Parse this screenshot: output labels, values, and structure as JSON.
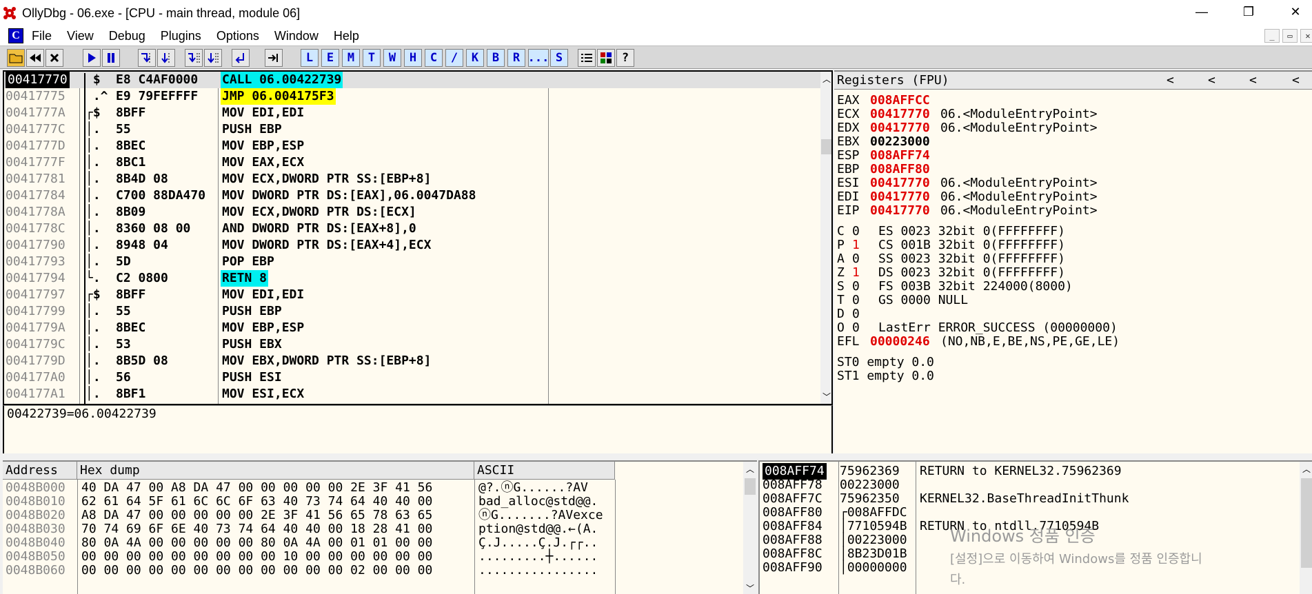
{
  "window": {
    "title": "OllyDbg - 06.exe - [CPU - main thread, module 06]",
    "minimize": "—",
    "restore": "❐",
    "close": "✕"
  },
  "menu": {
    "app_icon_letter": "C",
    "items": [
      "File",
      "View",
      "Debug",
      "Plugins",
      "Options",
      "Window",
      "Help"
    ],
    "mdi": [
      "_",
      "▭",
      "✕"
    ]
  },
  "toolbar": {
    "letters": [
      "L",
      "E",
      "M",
      "T",
      "W",
      "H",
      "C",
      "/",
      "K",
      "B",
      "R",
      "...",
      "S"
    ],
    "help": "?"
  },
  "disasm": {
    "rows": [
      {
        "addr": "00417770",
        "m": " $ ",
        "hex": "E8 C4AF0000",
        "asm": "CALL 06.00422739",
        "hl": "cyan",
        "sel": true
      },
      {
        "addr": "00417775",
        "m": " .^",
        "hex": "E9 79FEFFFF",
        "asm": "JMP 06.004175F3",
        "hl": "yellow"
      },
      {
        "addr": "0041777A",
        "m": "┌$ ",
        "hex": "8BFF",
        "asm": "MOV EDI,EDI"
      },
      {
        "addr": "0041777C",
        "m": "│. ",
        "hex": "55",
        "asm": "PUSH EBP"
      },
      {
        "addr": "0041777D",
        "m": "│. ",
        "hex": "8BEC",
        "asm": "MOV EBP,ESP"
      },
      {
        "addr": "0041777F",
        "m": "│. ",
        "hex": "8BC1",
        "asm": "MOV EAX,ECX"
      },
      {
        "addr": "00417781",
        "m": "│. ",
        "hex": "8B4D 08",
        "asm": "MOV ECX,DWORD PTR SS:[EBP+8]"
      },
      {
        "addr": "00417784",
        "m": "│. ",
        "hex": "C700 88DA470",
        "asm": "MOV DWORD PTR DS:[EAX],06.0047DA88"
      },
      {
        "addr": "0041778A",
        "m": "│. ",
        "hex": "8B09",
        "asm": "MOV ECX,DWORD PTR DS:[ECX]"
      },
      {
        "addr": "0041778C",
        "m": "│. ",
        "hex": "8360 08 00",
        "asm": "AND DWORD PTR DS:[EAX+8],0"
      },
      {
        "addr": "00417790",
        "m": "│. ",
        "hex": "8948 04",
        "asm": "MOV DWORD PTR DS:[EAX+4],ECX"
      },
      {
        "addr": "00417793",
        "m": "│. ",
        "hex": "5D",
        "asm": "POP EBP"
      },
      {
        "addr": "00417794",
        "m": "└. ",
        "hex": "C2 0800",
        "asm": "RETN 8",
        "hl": "cyan"
      },
      {
        "addr": "00417797",
        "m": "┌$ ",
        "hex": "8BFF",
        "asm": "MOV EDI,EDI"
      },
      {
        "addr": "00417799",
        "m": "│. ",
        "hex": "55",
        "asm": "PUSH EBP"
      },
      {
        "addr": "0041779A",
        "m": "│. ",
        "hex": "8BEC",
        "asm": "MOV EBP,ESP"
      },
      {
        "addr": "0041779C",
        "m": "│. ",
        "hex": "53",
        "asm": "PUSH EBX"
      },
      {
        "addr": "0041779D",
        "m": "│. ",
        "hex": "8B5D 08",
        "asm": "MOV EBX,DWORD PTR SS:[EBP+8]"
      },
      {
        "addr": "004177A0",
        "m": "│. ",
        "hex": "56",
        "asm": "PUSH ESI"
      },
      {
        "addr": "004177A1",
        "m": "│. ",
        "hex": "8BF1",
        "asm": "MOV ESI,ECX"
      }
    ]
  },
  "info_line": "00422739=06.00422739",
  "registers": {
    "header": "Registers (FPU)",
    "nav": [
      "<",
      "<",
      "<",
      "<"
    ],
    "gp": [
      {
        "name": "EAX",
        "val": "008AFFCC",
        "red": true,
        "desc": ""
      },
      {
        "name": "ECX",
        "val": "00417770",
        "red": true,
        "desc": "06.<ModuleEntryPoint>"
      },
      {
        "name": "EDX",
        "val": "00417770",
        "red": true,
        "desc": "06.<ModuleEntryPoint>"
      },
      {
        "name": "EBX",
        "val": "00223000",
        "red": false,
        "desc": ""
      },
      {
        "name": "ESP",
        "val": "008AFF74",
        "red": true,
        "desc": ""
      },
      {
        "name": "EBP",
        "val": "008AFF80",
        "red": true,
        "desc": ""
      },
      {
        "name": "ESI",
        "val": "00417770",
        "red": true,
        "desc": "06.<ModuleEntryPoint>"
      },
      {
        "name": "EDI",
        "val": "00417770",
        "red": true,
        "desc": "06.<ModuleEntryPoint>"
      }
    ],
    "eip": {
      "name": "EIP",
      "val": "00417770",
      "desc": "06.<ModuleEntryPoint>"
    },
    "flags": [
      {
        "f": "C",
        "v": "0",
        "red": false,
        "seg": "ES 0023 32bit 0(FFFFFFFF)"
      },
      {
        "f": "P",
        "v": "1",
        "red": true,
        "seg": "CS 001B 32bit 0(FFFFFFFF)"
      },
      {
        "f": "A",
        "v": "0",
        "red": false,
        "seg": "SS 0023 32bit 0(FFFFFFFF)"
      },
      {
        "f": "Z",
        "v": "1",
        "red": true,
        "seg": "DS 0023 32bit 0(FFFFFFFF)"
      },
      {
        "f": "S",
        "v": "0",
        "red": false,
        "seg": "FS 003B 32bit 224000(8000)"
      },
      {
        "f": "T",
        "v": "0",
        "red": false,
        "seg": "GS 0000 NULL"
      },
      {
        "f": "D",
        "v": "0",
        "red": false,
        "seg": ""
      },
      {
        "f": "O",
        "v": "0",
        "red": false,
        "seg": "LastErr ERROR_SUCCESS (00000000)"
      }
    ],
    "efl": {
      "name": "EFL",
      "val": "00000246",
      "desc": "(NO,NB,E,BE,NS,PE,GE,LE)"
    },
    "st": [
      "ST0 empty 0.0",
      "ST1 empty 0.0"
    ]
  },
  "dump": {
    "headers": {
      "address": "Address",
      "hex": "Hex dump",
      "ascii": "ASCII"
    },
    "rows": [
      {
        "addr": "0048B000",
        "hex": "40 DA 47 00 A8 DA 47 00 00 00 00 00 2E 3F 41 56",
        "ascii": "@?.ⓝG......?AV"
      },
      {
        "addr": "0048B010",
        "hex": "62 61 64 5F 61 6C 6C 6F 63 40 73 74 64 40 40 00",
        "ascii": "bad_alloc@std@@."
      },
      {
        "addr": "0048B020",
        "hex": "A8 DA 47 00 00 00 00 00 2E 3F 41 56 65 78 63 65",
        "ascii": "ⓝG.......?AVexce"
      },
      {
        "addr": "0048B030",
        "hex": "70 74 69 6F 6E 40 73 74 64 40 40 00 18 28 41 00",
        "ascii": "ption@std@@.←(A."
      },
      {
        "addr": "0048B040",
        "hex": "80 0A 4A 00 00 00 00 00 80 0A 4A 00 01 01 00 00",
        "ascii": "Ç.J.....Ç.J.┌┌.."
      },
      {
        "addr": "0048B050",
        "hex": "00 00 00 00 00 00 00 00 00 10 00 00 00 00 00 00",
        "ascii": ".........┼......"
      },
      {
        "addr": "0048B060",
        "hex": "00 00 00 00 00 00 00 00 00 00 00 00 02 00 00 00",
        "ascii": "................"
      }
    ]
  },
  "stack": {
    "rows": [
      {
        "addr": "008AFF74",
        "val": "75962369",
        "comment": "RETURN to KERNEL32.75962369",
        "sel": true
      },
      {
        "addr": "008AFF78",
        "val": "00223000",
        "comment": ""
      },
      {
        "addr": "008AFF7C",
        "val": "75962350",
        "comment": "KERNEL32.BaseThreadInitThunk"
      },
      {
        "addr": "008AFF80",
        "val": "┌008AFFDC",
        "comment": ""
      },
      {
        "addr": "008AFF84",
        "val": "│7710594B",
        "comment": "RETURN to ntdll.7710594B"
      },
      {
        "addr": "008AFF88",
        "val": "│00223000",
        "comment": ""
      },
      {
        "addr": "008AFF8C",
        "val": "│8B23D01B",
        "comment": ""
      },
      {
        "addr": "008AFF90",
        "val": "│00000000",
        "comment": ""
      }
    ]
  },
  "watermark": {
    "line1": "Windows 정품 인증",
    "line2": "[설정]으로 이동하여 Windows를 정품 인증합니",
    "line3": "다."
  },
  "colors": {
    "accent": "#0000c8",
    "highlight_cyan": "#00f0f0",
    "highlight_yellow": "#ffff00",
    "red": "#e00000",
    "pane_bg": "#fffbf0"
  }
}
